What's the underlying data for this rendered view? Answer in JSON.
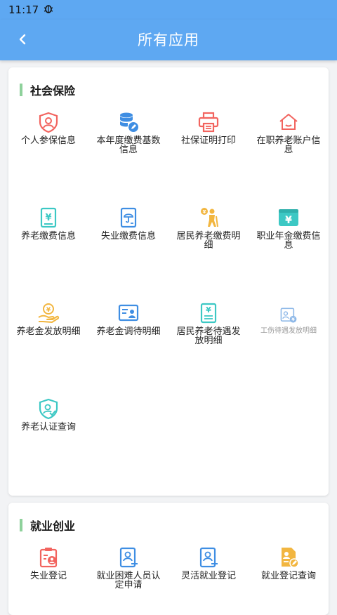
{
  "status": {
    "time": "11:17",
    "bug_icon": "bug-icon"
  },
  "header": {
    "title": "所有应用",
    "back_icon": "back-arrow-icon"
  },
  "colors": {
    "header_bg": "#5ea8f2",
    "section_bar": "#8ed19b",
    "icon_red": "#f2645f",
    "icon_blue": "#3f8ee3",
    "icon_teal": "#3cc8c4",
    "icon_gold": "#f2b640"
  },
  "sections": [
    {
      "title": "社会保险",
      "items": [
        {
          "label": "个人参保信息",
          "icon": "person-shield-icon"
        },
        {
          "label": "本年度缴费基数信息",
          "icon": "database-edit-icon"
        },
        {
          "label": "社保证明打印",
          "icon": "printer-icon"
        },
        {
          "label": "在职养老账户信息",
          "icon": "house-icon"
        },
        {
          "label": "养老缴费信息",
          "icon": "yuan-document-icon"
        },
        {
          "label": "失业缴费信息",
          "icon": "umbrella-document-icon"
        },
        {
          "label": "居民养老缴费明细",
          "icon": "elderly-person-icon"
        },
        {
          "label": "职业年金缴费信息",
          "icon": "yuan-card-icon"
        },
        {
          "label": "养老金发放明细",
          "icon": "hand-coin-icon"
        },
        {
          "label": "养老金调待明细",
          "icon": "id-card-icon"
        },
        {
          "label": "居民养老待遇发放明细",
          "icon": "yuan-list-icon"
        },
        {
          "label": "工伤待遇发放明细",
          "icon": "injury-card-icon"
        },
        {
          "label": "养老认证查询",
          "icon": "shield-check-icon"
        }
      ]
    },
    {
      "title": "就业创业",
      "items": [
        {
          "label": "失业登记",
          "icon": "clipboard-person-icon"
        },
        {
          "label": "就业困难人员认定申请",
          "icon": "person-form-icon"
        },
        {
          "label": "灵活就业登记",
          "icon": "person-form-icon"
        },
        {
          "label": "就业登记查询",
          "icon": "document-edit-icon"
        }
      ]
    }
  ]
}
